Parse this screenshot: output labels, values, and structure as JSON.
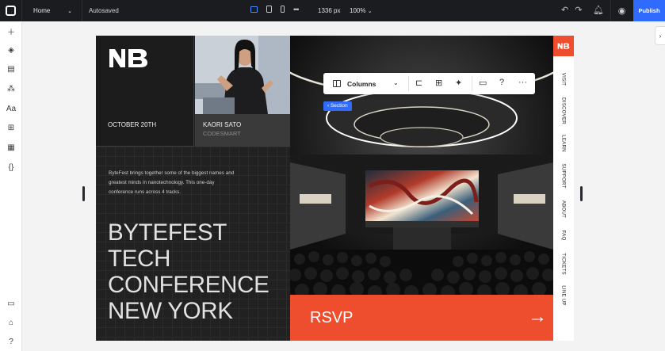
{
  "topbar": {
    "page": "Home",
    "status": "Autosaved",
    "breakpoint_width": "1336 px",
    "zoom": "100%",
    "publish_label": "Publish"
  },
  "rail": {
    "icons": [
      "add-icon",
      "layers-icon",
      "pages-icon",
      "components-icon",
      "text-styles-icon",
      "apps-icon",
      "cms-icon",
      "code-icon",
      "comments-icon",
      "learn-icon",
      "help-icon"
    ]
  },
  "toolbar": {
    "element_label": "Columns",
    "section_tag": "‹ Section"
  },
  "site": {
    "date": "OCTOBER 20TH",
    "speaker_name": "KAORI SATO",
    "speaker_org": "CODESMART",
    "description": "ByteFest brings together some of the biggest names and greatest minds in nanotechnology. This one-day conference runs across 4 tracks.",
    "headline": [
      "BYTEFEST",
      "TECH",
      "CONFERENCE",
      "NEW YORK"
    ],
    "rsvp_label": "RSVP",
    "nav": [
      "VISIT",
      "DISCOVER",
      "LEARN",
      "SUPPORT",
      "ABOUT",
      "FAQ",
      "TICKETS",
      "LINE UP"
    ],
    "accent_color": "#ef4e2e"
  }
}
